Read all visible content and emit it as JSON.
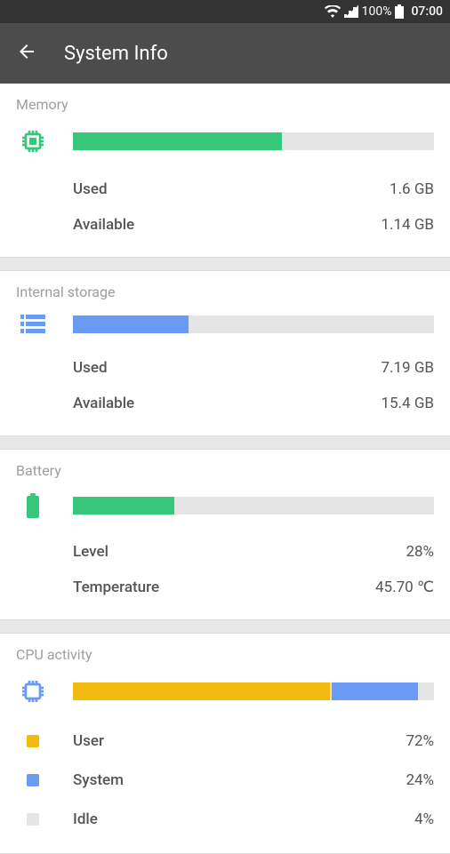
{
  "status": {
    "battery_pct": "100%",
    "time": "07:00"
  },
  "app_bar": {
    "title": "System Info"
  },
  "memory": {
    "title": "Memory",
    "used_label": "Used",
    "used_value": "1.6 GB",
    "available_label": "Available",
    "available_value": "1.14 GB",
    "fill_pct": 58
  },
  "storage": {
    "title": "Internal storage",
    "used_label": "Used",
    "used_value": "7.19 GB",
    "available_label": "Available",
    "available_value": "15.4 GB",
    "fill_pct": 32
  },
  "battery": {
    "title": "Battery",
    "level_label": "Level",
    "level_value": "28%",
    "temp_label": "Temperature",
    "temp_value": "45.70 ℃",
    "fill_pct": 28
  },
  "cpu": {
    "title": "CPU activity",
    "segments": [
      {
        "name": "User",
        "value": "72%",
        "pct": 72,
        "color": "#f2b90f"
      },
      {
        "name": "System",
        "value": "24%",
        "pct": 24,
        "color": "#6a9bf4"
      },
      {
        "name": "Idle",
        "value": "4%",
        "pct": 4,
        "color": "#e5e5e5"
      }
    ]
  },
  "chart_data": [
    {
      "type": "bar",
      "title": "Memory",
      "categories": [
        "Used",
        "Available"
      ],
      "values": [
        1.6,
        1.14
      ],
      "ylabel": "GB"
    },
    {
      "type": "bar",
      "title": "Internal storage",
      "categories": [
        "Used",
        "Available"
      ],
      "values": [
        7.19,
        15.4
      ],
      "ylabel": "GB"
    },
    {
      "type": "bar",
      "title": "Battery Level",
      "categories": [
        "Level"
      ],
      "values": [
        28
      ],
      "ylim": [
        0,
        100
      ],
      "ylabel": "%"
    },
    {
      "type": "bar",
      "title": "CPU activity",
      "categories": [
        "User",
        "System",
        "Idle"
      ],
      "values": [
        72,
        24,
        4
      ],
      "ylim": [
        0,
        100
      ],
      "ylabel": "%"
    }
  ]
}
